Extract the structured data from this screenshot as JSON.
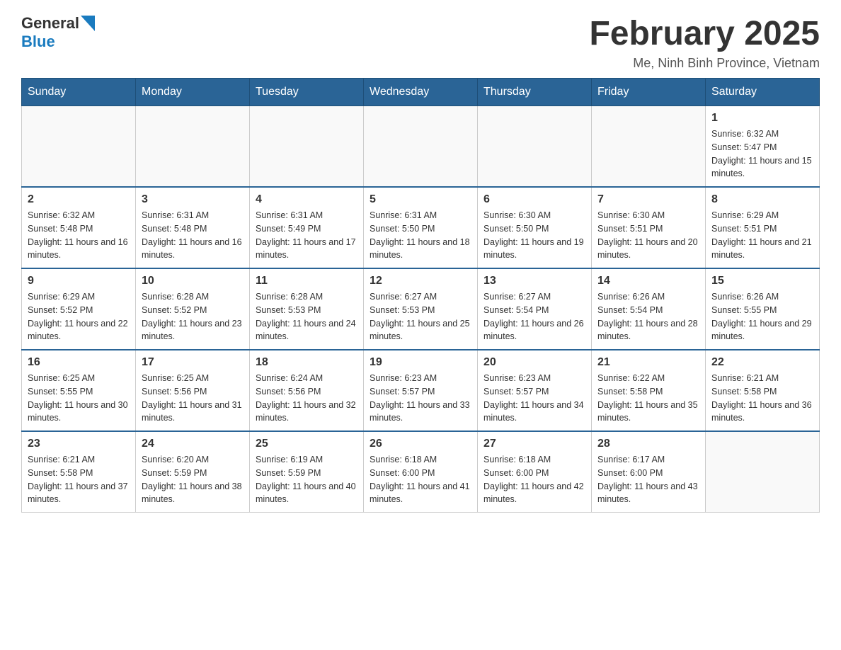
{
  "header": {
    "logo_general": "General",
    "logo_blue": "Blue",
    "month_title": "February 2025",
    "location": "Me, Ninh Binh Province, Vietnam"
  },
  "weekdays": [
    "Sunday",
    "Monday",
    "Tuesday",
    "Wednesday",
    "Thursday",
    "Friday",
    "Saturday"
  ],
  "weeks": [
    [
      {
        "day": "",
        "info": ""
      },
      {
        "day": "",
        "info": ""
      },
      {
        "day": "",
        "info": ""
      },
      {
        "day": "",
        "info": ""
      },
      {
        "day": "",
        "info": ""
      },
      {
        "day": "",
        "info": ""
      },
      {
        "day": "1",
        "info": "Sunrise: 6:32 AM\nSunset: 5:47 PM\nDaylight: 11 hours and 15 minutes."
      }
    ],
    [
      {
        "day": "2",
        "info": "Sunrise: 6:32 AM\nSunset: 5:48 PM\nDaylight: 11 hours and 16 minutes."
      },
      {
        "day": "3",
        "info": "Sunrise: 6:31 AM\nSunset: 5:48 PM\nDaylight: 11 hours and 16 minutes."
      },
      {
        "day": "4",
        "info": "Sunrise: 6:31 AM\nSunset: 5:49 PM\nDaylight: 11 hours and 17 minutes."
      },
      {
        "day": "5",
        "info": "Sunrise: 6:31 AM\nSunset: 5:50 PM\nDaylight: 11 hours and 18 minutes."
      },
      {
        "day": "6",
        "info": "Sunrise: 6:30 AM\nSunset: 5:50 PM\nDaylight: 11 hours and 19 minutes."
      },
      {
        "day": "7",
        "info": "Sunrise: 6:30 AM\nSunset: 5:51 PM\nDaylight: 11 hours and 20 minutes."
      },
      {
        "day": "8",
        "info": "Sunrise: 6:29 AM\nSunset: 5:51 PM\nDaylight: 11 hours and 21 minutes."
      }
    ],
    [
      {
        "day": "9",
        "info": "Sunrise: 6:29 AM\nSunset: 5:52 PM\nDaylight: 11 hours and 22 minutes."
      },
      {
        "day": "10",
        "info": "Sunrise: 6:28 AM\nSunset: 5:52 PM\nDaylight: 11 hours and 23 minutes."
      },
      {
        "day": "11",
        "info": "Sunrise: 6:28 AM\nSunset: 5:53 PM\nDaylight: 11 hours and 24 minutes."
      },
      {
        "day": "12",
        "info": "Sunrise: 6:27 AM\nSunset: 5:53 PM\nDaylight: 11 hours and 25 minutes."
      },
      {
        "day": "13",
        "info": "Sunrise: 6:27 AM\nSunset: 5:54 PM\nDaylight: 11 hours and 26 minutes."
      },
      {
        "day": "14",
        "info": "Sunrise: 6:26 AM\nSunset: 5:54 PM\nDaylight: 11 hours and 28 minutes."
      },
      {
        "day": "15",
        "info": "Sunrise: 6:26 AM\nSunset: 5:55 PM\nDaylight: 11 hours and 29 minutes."
      }
    ],
    [
      {
        "day": "16",
        "info": "Sunrise: 6:25 AM\nSunset: 5:55 PM\nDaylight: 11 hours and 30 minutes."
      },
      {
        "day": "17",
        "info": "Sunrise: 6:25 AM\nSunset: 5:56 PM\nDaylight: 11 hours and 31 minutes."
      },
      {
        "day": "18",
        "info": "Sunrise: 6:24 AM\nSunset: 5:56 PM\nDaylight: 11 hours and 32 minutes."
      },
      {
        "day": "19",
        "info": "Sunrise: 6:23 AM\nSunset: 5:57 PM\nDaylight: 11 hours and 33 minutes."
      },
      {
        "day": "20",
        "info": "Sunrise: 6:23 AM\nSunset: 5:57 PM\nDaylight: 11 hours and 34 minutes."
      },
      {
        "day": "21",
        "info": "Sunrise: 6:22 AM\nSunset: 5:58 PM\nDaylight: 11 hours and 35 minutes."
      },
      {
        "day": "22",
        "info": "Sunrise: 6:21 AM\nSunset: 5:58 PM\nDaylight: 11 hours and 36 minutes."
      }
    ],
    [
      {
        "day": "23",
        "info": "Sunrise: 6:21 AM\nSunset: 5:58 PM\nDaylight: 11 hours and 37 minutes."
      },
      {
        "day": "24",
        "info": "Sunrise: 6:20 AM\nSunset: 5:59 PM\nDaylight: 11 hours and 38 minutes."
      },
      {
        "day": "25",
        "info": "Sunrise: 6:19 AM\nSunset: 5:59 PM\nDaylight: 11 hours and 40 minutes."
      },
      {
        "day": "26",
        "info": "Sunrise: 6:18 AM\nSunset: 6:00 PM\nDaylight: 11 hours and 41 minutes."
      },
      {
        "day": "27",
        "info": "Sunrise: 6:18 AM\nSunset: 6:00 PM\nDaylight: 11 hours and 42 minutes."
      },
      {
        "day": "28",
        "info": "Sunrise: 6:17 AM\nSunset: 6:00 PM\nDaylight: 11 hours and 43 minutes."
      },
      {
        "day": "",
        "info": ""
      }
    ]
  ]
}
